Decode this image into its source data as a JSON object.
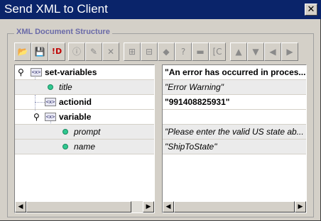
{
  "window": {
    "title": "Send XML to Client",
    "close_label": "✕"
  },
  "group": {
    "label": "XML Document Structure"
  },
  "toolbar": {
    "buttons": [
      {
        "name": "open-icon",
        "glyph": "📂",
        "enabled": true
      },
      {
        "name": "save-icon",
        "glyph": "💾",
        "enabled": true
      },
      {
        "name": "id-icon",
        "glyph": "!D",
        "enabled": true
      },
      {
        "name": "info-icon",
        "glyph": "ⓘ",
        "enabled": false
      },
      {
        "name": "edit-icon",
        "glyph": "✎",
        "enabled": false
      },
      {
        "name": "delete-icon",
        "glyph": "✕",
        "enabled": false
      },
      {
        "name": "add-child-icon",
        "glyph": "⊞",
        "enabled": false
      },
      {
        "name": "add-sibling-icon",
        "glyph": "⊟",
        "enabled": false
      },
      {
        "name": "tag-icon",
        "glyph": "◆",
        "enabled": false
      },
      {
        "name": "help-icon",
        "glyph": "?",
        "enabled": false
      },
      {
        "name": "comment-icon",
        "glyph": "▬",
        "enabled": false
      },
      {
        "name": "cdata-icon",
        "glyph": "[C",
        "enabled": false
      },
      {
        "name": "move-up-icon",
        "glyph": "▲",
        "enabled": false
      },
      {
        "name": "move-down-icon",
        "glyph": "▼",
        "enabled": false
      },
      {
        "name": "move-left-icon",
        "glyph": "◀",
        "enabled": false
      },
      {
        "name": "move-right-icon",
        "glyph": "▶",
        "enabled": false
      }
    ]
  },
  "tree": {
    "rows": [
      {
        "name": "set-variables",
        "kind": "element",
        "style": "bold",
        "value": "\"An error has occurred in proces...",
        "value_style": "bold"
      },
      {
        "name": "title",
        "kind": "attribute",
        "style": "italic",
        "value": "\"Error Warning\"",
        "value_style": "italic"
      },
      {
        "name": "actionid",
        "kind": "element",
        "style": "bold",
        "value": "\"991408825931\"",
        "value_style": "bold"
      },
      {
        "name": "variable",
        "kind": "element",
        "style": "bold",
        "value": "",
        "value_style": "bold"
      },
      {
        "name": "prompt",
        "kind": "attribute",
        "style": "italic",
        "value": "\"Please enter the valid US state ab...",
        "value_style": "italic"
      },
      {
        "name": "name",
        "kind": "attribute",
        "style": "italic",
        "value": "\"ShipToState\"",
        "value_style": "italic"
      }
    ],
    "element_icon_text": "<x>"
  },
  "scrollbars": {
    "left_arrow": "◀",
    "right_arrow": "▶"
  },
  "colors": {
    "titlebar": "#0a246a",
    "group_label": "#6b6ba8",
    "window_bg": "#d4d0c8"
  }
}
